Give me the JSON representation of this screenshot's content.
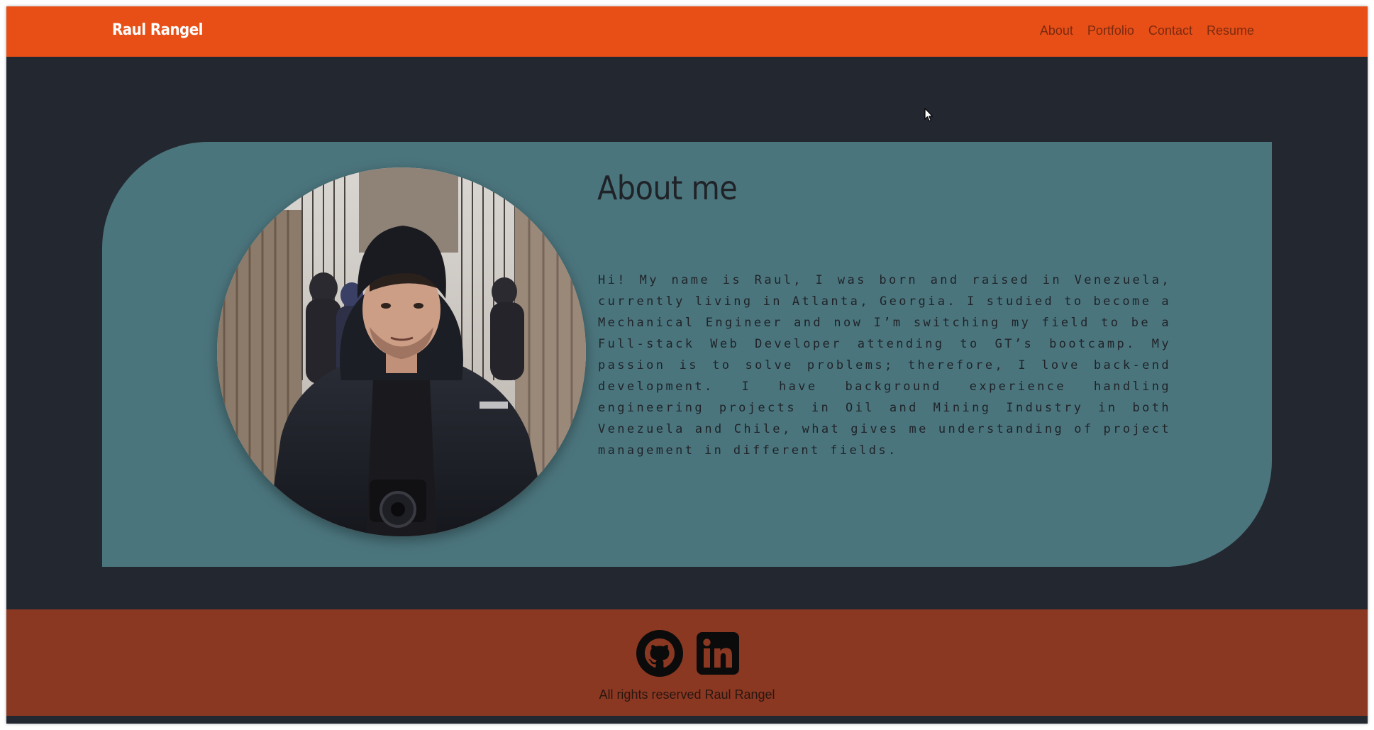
{
  "navbar": {
    "brand": "Raul Rangel",
    "links": [
      {
        "label": "About"
      },
      {
        "label": "Portfolio"
      },
      {
        "label": "Contact"
      },
      {
        "label": "Resume"
      }
    ]
  },
  "about": {
    "title": "About me",
    "text": "Hi! My name is Raul, I was born and raised in Venezuela, currently living in Atlanta, Georgia. I studied to become a Mechanical Engineer and now I’m switching my field to be a Full-stack Web Developer attending to GT’s bootcamp. My passion is to solve problems; therefore, I love back-end development. I have background experience handling engineering projects in Oil and Mining Industry in both Venezuela and Chile, what gives me understanding of project management in different fields.",
    "photo_icon": "profile-photo"
  },
  "footer": {
    "social": [
      {
        "icon": "github-icon"
      },
      {
        "icon": "linkedin-icon"
      }
    ],
    "copyright": "All rights reserved Raul Rangel"
  },
  "colors": {
    "navbar_bg": "#e84f17",
    "page_bg": "#232730",
    "card_bg": "#4b757d",
    "footer_bg": "#8a3822"
  }
}
